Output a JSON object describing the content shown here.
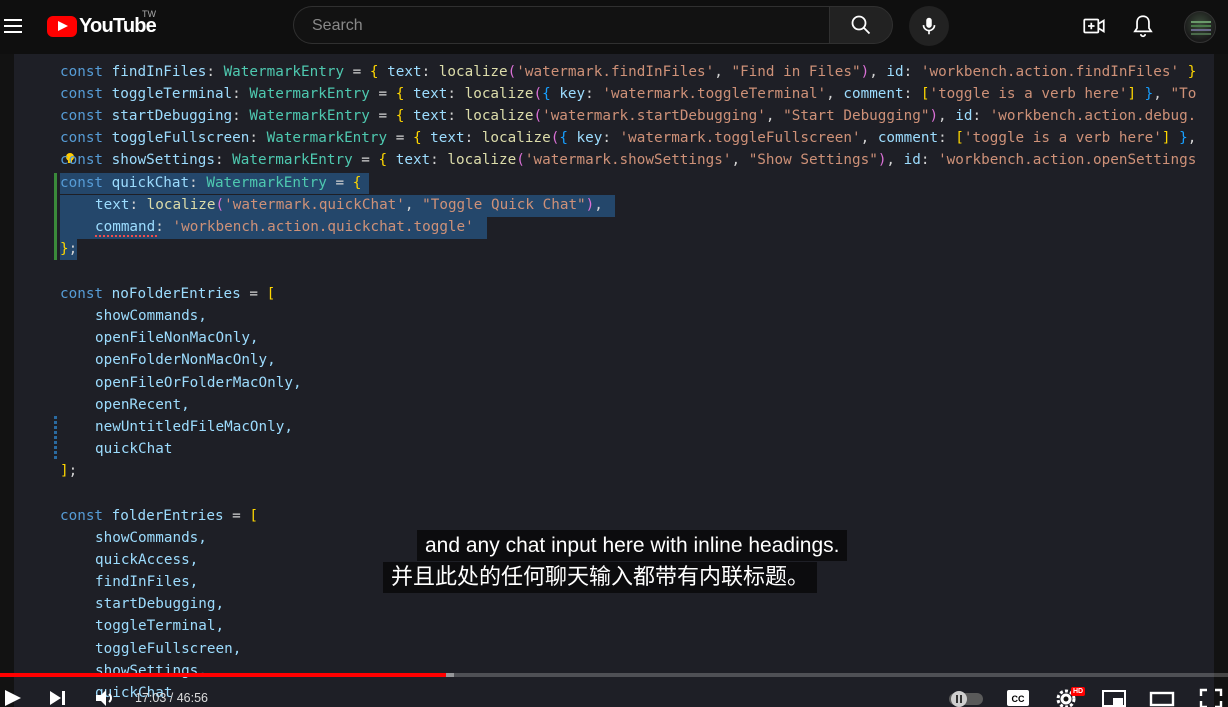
{
  "header": {
    "logo_text": "YouTube",
    "logo_region": "TW",
    "search_placeholder": "Search"
  },
  "code": {
    "line1": {
      "decl": "findInFiles",
      "type": "WatermarkEntry",
      "key": "watermark.findInFiles",
      "label": "\"Find in Files\"",
      "id": "'workbench.action.findInFiles'",
      "tail": " }"
    },
    "line2": {
      "decl": "toggleTerminal",
      "type": "WatermarkEntry",
      "key": "'watermark.toggleTerminal'",
      "comment": "'toggle is a verb here'",
      "tail": "\"To"
    },
    "line3": {
      "decl": "startDebugging",
      "type": "WatermarkEntry",
      "key": "'watermark.startDebugging'",
      "label": "\"Start Debugging\"",
      "id": "'workbench.action.debug."
    },
    "line4": {
      "decl": "toggleFullscreen",
      "type": "WatermarkEntry",
      "key": "'watermark.toggleFullscreen'",
      "comment": "'toggle is a verb here'"
    },
    "line5": {
      "decl": "showSettings",
      "type": "WatermarkEntry",
      "key": "'watermark.showSettings'",
      "label": "\"Show Settings\"",
      "id": "'workbench.action.openSettings"
    },
    "quickchat": {
      "decl": "quickChat",
      "type": "WatermarkEntry",
      "key": "'watermark.quickChat'",
      "label": "\"Toggle Quick Chat\"",
      "command": "'workbench.action.quickchat.toggle'"
    },
    "no_folder": {
      "decl": "noFolderEntries",
      "items": [
        "showCommands,",
        "openFileNonMacOnly,",
        "openFolderNonMacOnly,",
        "openFileOrFolderMacOnly,",
        "openRecent,",
        "newUntitledFileMacOnly,",
        "quickChat"
      ]
    },
    "folder": {
      "decl": "folderEntries",
      "items": [
        "showCommands,",
        "quickAccess,",
        "findInFiles,",
        "startDebugging,",
        "toggleTerminal,",
        "toggleFullscreen,",
        "showSettings,",
        "quickChat"
      ]
    }
  },
  "captions": {
    "en": "and any chat input here with inline headings.",
    "zh": "并且此处的任何聊天输入都带有内联标题。"
  },
  "player": {
    "time_current": "17:03",
    "time_separator": " / ",
    "time_total": "46:56",
    "played_fraction": 0.363,
    "loaded_fraction": 0.37,
    "hd_label": "HD"
  }
}
